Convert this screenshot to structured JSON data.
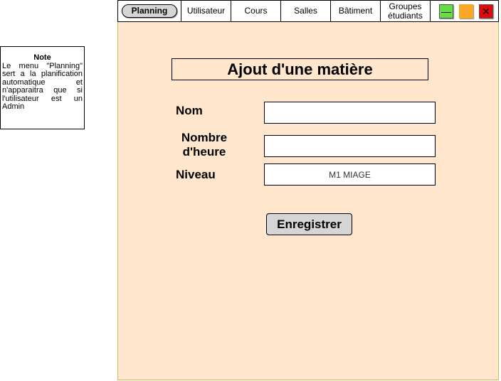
{
  "note": {
    "title": "Note",
    "text": "Le menu \"Planning\" sert a la planification automatique et n'apparaitra que si l'utilisateur est un Admin"
  },
  "menu": {
    "items": [
      {
        "label": "Planning"
      },
      {
        "label": "Utilisateur"
      },
      {
        "label": "Cours"
      },
      {
        "label": "Salles"
      },
      {
        "label": "Bâtiment"
      },
      {
        "label": "Groupes étudiants"
      }
    ]
  },
  "window_controls": {
    "minimize_glyph": "—",
    "close_glyph": "✕"
  },
  "form": {
    "title": "Ajout d'une matière",
    "nom_label": "Nom",
    "nom_value": "",
    "heures_label": "Nombre d'heure",
    "heures_value": "",
    "niveau_label": "Niveau",
    "niveau_value": "M1 MIAGE",
    "save_label": "Enregistrer"
  },
  "colors": {
    "content_background": "#ffe6cc",
    "content_border": "#d6b656",
    "minimize": "#66dd44",
    "maximize": "#f8a825",
    "close": "#e20b0b"
  }
}
